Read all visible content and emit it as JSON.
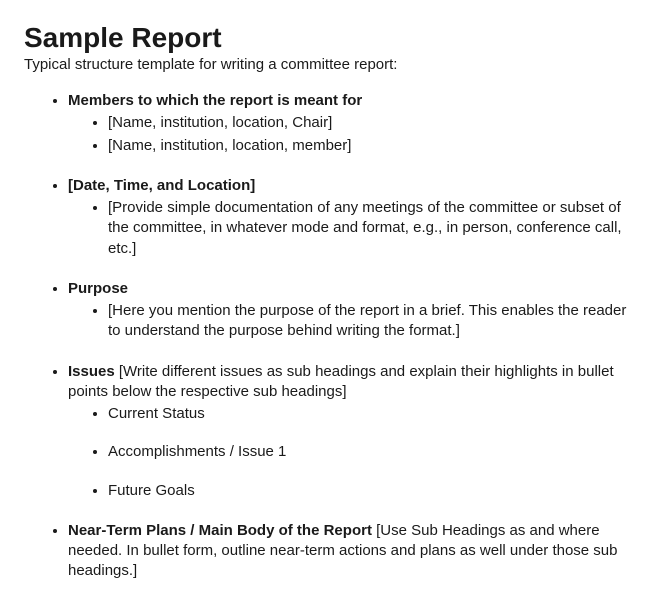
{
  "title": "Sample Report",
  "intro": "Typical structure template for writing a committee report:",
  "items": [
    {
      "bold": "Members to which the report is meant for",
      "trail": "",
      "sub_gap": false,
      "sub_spaced": false,
      "sub": [
        "[Name, institution, location, Chair]",
        "[Name, institution, location, member]"
      ]
    },
    {
      "bold": "[Date, Time, and Location]",
      "trail": "",
      "sub_gap": true,
      "sub_spaced": false,
      "sub": [
        "[Provide simple documentation of any meetings of the committee or subset of the committee, in whatever mode and format, e.g., in person, conference call, etc.]"
      ]
    },
    {
      "bold": "Purpose",
      "trail": "",
      "sub_gap": true,
      "sub_spaced": false,
      "sub": [
        "[Here you mention the purpose of the report in a brief. This enables the reader to understand the purpose behind writing the format.]"
      ]
    },
    {
      "bold": "Issues",
      "trail": " [Write different issues as sub headings and explain their highlights in bullet points below the respective sub headings]",
      "sub_gap": true,
      "sub_spaced": true,
      "sub": [
        "Current Status",
        "Accomplishments / Issue 1",
        "Future Goals"
      ]
    },
    {
      "bold": "Near-Term Plans / Main Body of the Report",
      "trail": " [Use Sub Headings as and where needed. In bullet form, outline near-term actions and plans as well under those sub headings.]",
      "sub_gap": false,
      "sub_spaced": false,
      "sub": []
    }
  ]
}
